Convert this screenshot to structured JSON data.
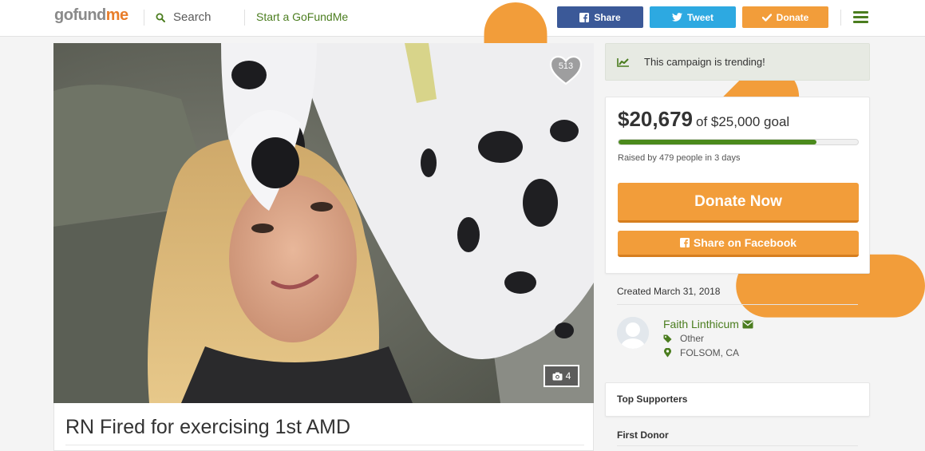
{
  "header": {
    "logo": {
      "go": "go",
      "fund": "fund",
      "me": "me"
    },
    "search_label": "Search",
    "start_label": "Start a GoFundMe",
    "share_label": "Share",
    "tweet_label": "Tweet",
    "donate_label": "Donate"
  },
  "photo": {
    "likes": "513",
    "photo_count": "4"
  },
  "campaign": {
    "title": "RN Fired for exercising 1st AMD"
  },
  "sidebar": {
    "trending_text": "This campaign is trending!",
    "raised_amount": "$20,679",
    "goal_text": "of $25,000 goal",
    "progress_fraction": 0.827,
    "raised_by": "Raised by 479 people in 3 days",
    "donate_now": "Donate Now",
    "share_facebook": "Share on Facebook",
    "created": "Created March 31, 2018",
    "organizer": {
      "name": "Faith Linthicum",
      "category": "Other",
      "location": "FOLSOM, CA"
    },
    "top_supporters": "Top Supporters",
    "first_donor": "First Donor"
  },
  "colors": {
    "brand_green": "#4b7d1f",
    "brand_orange": "#f29d3a",
    "facebook_blue": "#3b5998",
    "twitter_blue": "#2da9e1"
  },
  "icons": [
    "search-icon",
    "facebook-icon",
    "twitter-icon",
    "check-icon",
    "menu-icon",
    "heart-icon",
    "camera-icon",
    "trending-icon",
    "envelope-icon",
    "tag-icon",
    "map-marker-icon",
    "avatar"
  ]
}
